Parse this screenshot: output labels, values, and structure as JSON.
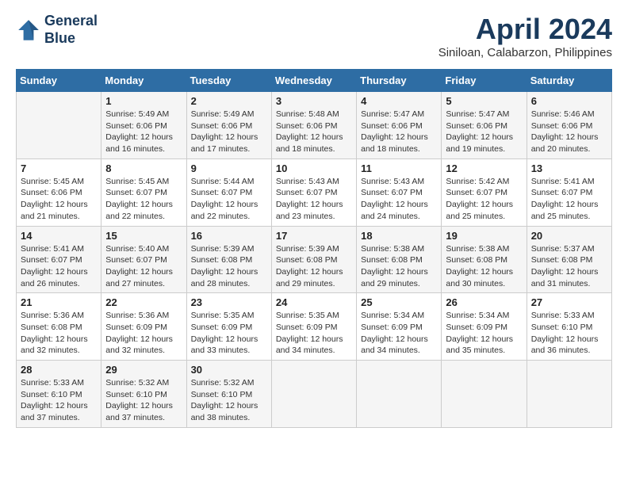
{
  "header": {
    "logo_line1": "General",
    "logo_line2": "Blue",
    "month_title": "April 2024",
    "location": "Siniloan, Calabarzon, Philippines"
  },
  "days_of_week": [
    "Sunday",
    "Monday",
    "Tuesday",
    "Wednesday",
    "Thursday",
    "Friday",
    "Saturday"
  ],
  "weeks": [
    [
      {
        "day": "",
        "sunrise": "",
        "sunset": "",
        "daylight": ""
      },
      {
        "day": "1",
        "sunrise": "Sunrise: 5:49 AM",
        "sunset": "Sunset: 6:06 PM",
        "daylight": "Daylight: 12 hours and 16 minutes."
      },
      {
        "day": "2",
        "sunrise": "Sunrise: 5:49 AM",
        "sunset": "Sunset: 6:06 PM",
        "daylight": "Daylight: 12 hours and 17 minutes."
      },
      {
        "day": "3",
        "sunrise": "Sunrise: 5:48 AM",
        "sunset": "Sunset: 6:06 PM",
        "daylight": "Daylight: 12 hours and 18 minutes."
      },
      {
        "day": "4",
        "sunrise": "Sunrise: 5:47 AM",
        "sunset": "Sunset: 6:06 PM",
        "daylight": "Daylight: 12 hours and 18 minutes."
      },
      {
        "day": "5",
        "sunrise": "Sunrise: 5:47 AM",
        "sunset": "Sunset: 6:06 PM",
        "daylight": "Daylight: 12 hours and 19 minutes."
      },
      {
        "day": "6",
        "sunrise": "Sunrise: 5:46 AM",
        "sunset": "Sunset: 6:06 PM",
        "daylight": "Daylight: 12 hours and 20 minutes."
      }
    ],
    [
      {
        "day": "7",
        "sunrise": "Sunrise: 5:45 AM",
        "sunset": "Sunset: 6:06 PM",
        "daylight": "Daylight: 12 hours and 21 minutes."
      },
      {
        "day": "8",
        "sunrise": "Sunrise: 5:45 AM",
        "sunset": "Sunset: 6:07 PM",
        "daylight": "Daylight: 12 hours and 22 minutes."
      },
      {
        "day": "9",
        "sunrise": "Sunrise: 5:44 AM",
        "sunset": "Sunset: 6:07 PM",
        "daylight": "Daylight: 12 hours and 22 minutes."
      },
      {
        "day": "10",
        "sunrise": "Sunrise: 5:43 AM",
        "sunset": "Sunset: 6:07 PM",
        "daylight": "Daylight: 12 hours and 23 minutes."
      },
      {
        "day": "11",
        "sunrise": "Sunrise: 5:43 AM",
        "sunset": "Sunset: 6:07 PM",
        "daylight": "Daylight: 12 hours and 24 minutes."
      },
      {
        "day": "12",
        "sunrise": "Sunrise: 5:42 AM",
        "sunset": "Sunset: 6:07 PM",
        "daylight": "Daylight: 12 hours and 25 minutes."
      },
      {
        "day": "13",
        "sunrise": "Sunrise: 5:41 AM",
        "sunset": "Sunset: 6:07 PM",
        "daylight": "Daylight: 12 hours and 25 minutes."
      }
    ],
    [
      {
        "day": "14",
        "sunrise": "Sunrise: 5:41 AM",
        "sunset": "Sunset: 6:07 PM",
        "daylight": "Daylight: 12 hours and 26 minutes."
      },
      {
        "day": "15",
        "sunrise": "Sunrise: 5:40 AM",
        "sunset": "Sunset: 6:07 PM",
        "daylight": "Daylight: 12 hours and 27 minutes."
      },
      {
        "day": "16",
        "sunrise": "Sunrise: 5:39 AM",
        "sunset": "Sunset: 6:08 PM",
        "daylight": "Daylight: 12 hours and 28 minutes."
      },
      {
        "day": "17",
        "sunrise": "Sunrise: 5:39 AM",
        "sunset": "Sunset: 6:08 PM",
        "daylight": "Daylight: 12 hours and 29 minutes."
      },
      {
        "day": "18",
        "sunrise": "Sunrise: 5:38 AM",
        "sunset": "Sunset: 6:08 PM",
        "daylight": "Daylight: 12 hours and 29 minutes."
      },
      {
        "day": "19",
        "sunrise": "Sunrise: 5:38 AM",
        "sunset": "Sunset: 6:08 PM",
        "daylight": "Daylight: 12 hours and 30 minutes."
      },
      {
        "day": "20",
        "sunrise": "Sunrise: 5:37 AM",
        "sunset": "Sunset: 6:08 PM",
        "daylight": "Daylight: 12 hours and 31 minutes."
      }
    ],
    [
      {
        "day": "21",
        "sunrise": "Sunrise: 5:36 AM",
        "sunset": "Sunset: 6:08 PM",
        "daylight": "Daylight: 12 hours and 32 minutes."
      },
      {
        "day": "22",
        "sunrise": "Sunrise: 5:36 AM",
        "sunset": "Sunset: 6:09 PM",
        "daylight": "Daylight: 12 hours and 32 minutes."
      },
      {
        "day": "23",
        "sunrise": "Sunrise: 5:35 AM",
        "sunset": "Sunset: 6:09 PM",
        "daylight": "Daylight: 12 hours and 33 minutes."
      },
      {
        "day": "24",
        "sunrise": "Sunrise: 5:35 AM",
        "sunset": "Sunset: 6:09 PM",
        "daylight": "Daylight: 12 hours and 34 minutes."
      },
      {
        "day": "25",
        "sunrise": "Sunrise: 5:34 AM",
        "sunset": "Sunset: 6:09 PM",
        "daylight": "Daylight: 12 hours and 34 minutes."
      },
      {
        "day": "26",
        "sunrise": "Sunrise: 5:34 AM",
        "sunset": "Sunset: 6:09 PM",
        "daylight": "Daylight: 12 hours and 35 minutes."
      },
      {
        "day": "27",
        "sunrise": "Sunrise: 5:33 AM",
        "sunset": "Sunset: 6:10 PM",
        "daylight": "Daylight: 12 hours and 36 minutes."
      }
    ],
    [
      {
        "day": "28",
        "sunrise": "Sunrise: 5:33 AM",
        "sunset": "Sunset: 6:10 PM",
        "daylight": "Daylight: 12 hours and 37 minutes."
      },
      {
        "day": "29",
        "sunrise": "Sunrise: 5:32 AM",
        "sunset": "Sunset: 6:10 PM",
        "daylight": "Daylight: 12 hours and 37 minutes."
      },
      {
        "day": "30",
        "sunrise": "Sunrise: 5:32 AM",
        "sunset": "Sunset: 6:10 PM",
        "daylight": "Daylight: 12 hours and 38 minutes."
      },
      {
        "day": "",
        "sunrise": "",
        "sunset": "",
        "daylight": ""
      },
      {
        "day": "",
        "sunrise": "",
        "sunset": "",
        "daylight": ""
      },
      {
        "day": "",
        "sunrise": "",
        "sunset": "",
        "daylight": ""
      },
      {
        "day": "",
        "sunrise": "",
        "sunset": "",
        "daylight": ""
      }
    ]
  ]
}
